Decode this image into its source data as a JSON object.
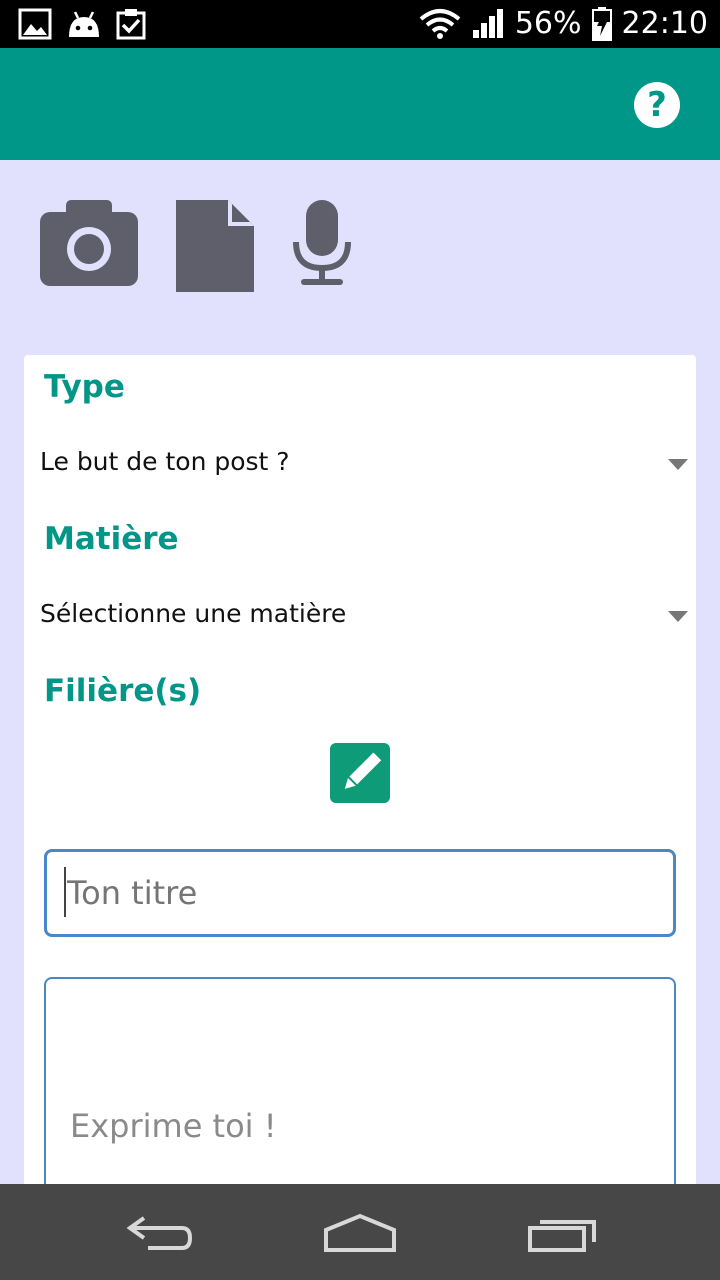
{
  "status_bar": {
    "battery": "56%",
    "time": "22:10",
    "icons": [
      "image-icon",
      "android-icon",
      "clipboard-check-icon",
      "wifi-icon",
      "signal-icon",
      "battery-charging-icon"
    ]
  },
  "app_bar": {
    "help_label": "?",
    "color": "#009688"
  },
  "media_icons": [
    "camera-icon",
    "file-icon",
    "microphone-icon"
  ],
  "form": {
    "type_label": "Type",
    "type_value": "Le but de ton post ?",
    "subject_label": "Matière",
    "subject_value": "Sélectionne une matière",
    "branches_label": "Filière(s)",
    "title_placeholder": "Ton titre",
    "body_placeholder": "Exprime toi !"
  },
  "nav_bar": {
    "icons": [
      "back-icon",
      "home-icon",
      "recents-icon"
    ]
  }
}
